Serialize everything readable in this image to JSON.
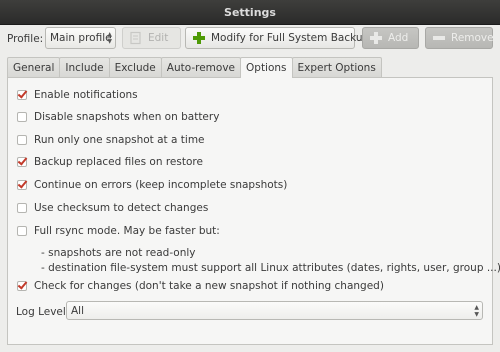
{
  "window": {
    "title": "Settings"
  },
  "toolbar": {
    "profile_label": "Profile:",
    "profile_value": "Main profile",
    "edit_label": "Edit",
    "modify_label": "Modify for Full System Backup",
    "add_label": "Add",
    "remove_label": "Remove"
  },
  "tabs": [
    {
      "label": "General",
      "active": false
    },
    {
      "label": "Include",
      "active": false
    },
    {
      "label": "Exclude",
      "active": false
    },
    {
      "label": "Auto-remove",
      "active": false
    },
    {
      "label": "Options",
      "active": true
    },
    {
      "label": "Expert Options",
      "active": false
    }
  ],
  "options": [
    {
      "label": "Enable notifications",
      "checked": true
    },
    {
      "label": "Disable snapshots when on battery",
      "checked": false
    },
    {
      "label": "Run only one snapshot at a time",
      "checked": false
    },
    {
      "label": "Backup replaced files on restore",
      "checked": true
    },
    {
      "label": "Continue on errors (keep incomplete snapshots)",
      "checked": true
    },
    {
      "label": "Use checksum to detect changes",
      "checked": false
    },
    {
      "label": "Full rsync mode. May be faster but:",
      "checked": false
    },
    {
      "label": "Check for changes (don't take a new snapshot if nothing changed)",
      "checked": true
    }
  ],
  "rsync_notes": [
    "- snapshots are not read-only",
    "- destination file-system must support all Linux attributes (dates, rights, user, group ...)"
  ],
  "log_level": {
    "label": "Log Level:",
    "value": "All"
  },
  "colors": {
    "check": "#c23a2a",
    "add_icon": "#4e9a06",
    "titlebar": "#333332"
  },
  "icons": {
    "edit": "edit-icon",
    "modify": "plus-icon",
    "add": "plus-icon",
    "remove": "minus-icon"
  }
}
